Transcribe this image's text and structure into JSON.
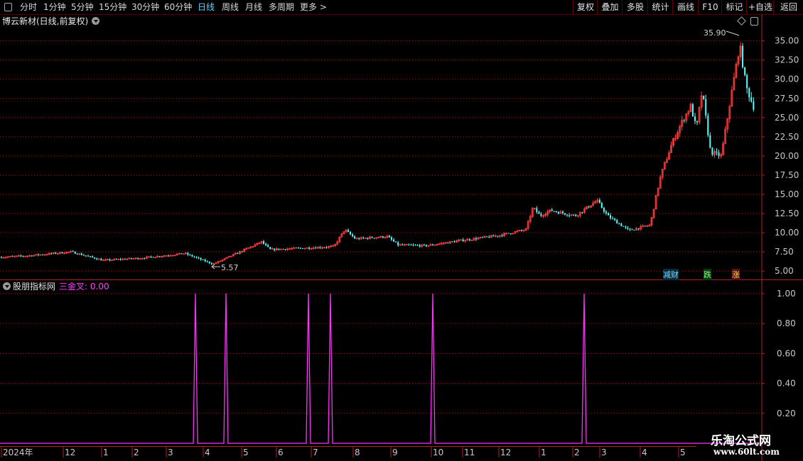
{
  "toolbar": {
    "periods": [
      {
        "label": "分时"
      },
      {
        "label": "1分钟"
      },
      {
        "label": "5分钟"
      },
      {
        "label": "15分钟"
      },
      {
        "label": "30分钟"
      },
      {
        "label": "60分钟"
      },
      {
        "label": "日线"
      },
      {
        "label": "周线"
      },
      {
        "label": "月线"
      },
      {
        "label": "多周期"
      },
      {
        "label": "更多 >"
      }
    ],
    "active_period": "日线",
    "actions": [
      {
        "label": "复权"
      },
      {
        "label": "叠加"
      },
      {
        "label": "多股"
      },
      {
        "label": "统计"
      },
      {
        "label": "画线"
      },
      {
        "label": "F10"
      },
      {
        "label": "标记"
      },
      {
        "label": "+自选"
      },
      {
        "label": "返回"
      }
    ]
  },
  "main_panel": {
    "title": "博云新材(日线,前复权)",
    "y_ticks": [
      "35.00",
      "32.50",
      "30.00",
      "27.50",
      "25.00",
      "22.50",
      "20.00",
      "17.50",
      "15.00",
      "12.50",
      "10.00",
      "7.50",
      "5.00"
    ],
    "high_label": "35.90",
    "low_label": "5.57",
    "markers": [
      "减财",
      "跌",
      "涨"
    ]
  },
  "indicator_panel": {
    "name": "股朋指标网",
    "series_label": "三金叉: 0.00",
    "y_ticks": [
      "1.00",
      "0.80",
      "0.60",
      "0.40",
      "0.20"
    ]
  },
  "x_axis": {
    "labels": [
      "2024年",
      "12",
      "1",
      "2",
      "3",
      "4",
      "5",
      "6",
      "7",
      "8",
      "9",
      "10",
      "11",
      "12",
      "1",
      "2",
      "3",
      "4",
      "5"
    ]
  },
  "watermark": {
    "cn": "乐淘公式网",
    "url": "www.60lt.com"
  },
  "colors": {
    "up": "#ff3c3c",
    "down": "#54ffff",
    "grid": "#8a1a1a",
    "indicator": "#ff30ff",
    "axis_text": "#c8c8c8"
  },
  "chart_data": {
    "type": "candlestick",
    "title": "博云新材(日线,前复权)",
    "ylim": [
      4.0,
      37.0
    ],
    "y_ticks": [
      35.0,
      32.5,
      30.0,
      27.5,
      25.0,
      22.5,
      20.0,
      17.5,
      15.0,
      12.5,
      10.0,
      7.5,
      5.0
    ],
    "x_labels": [
      "2024年",
      "12",
      "1",
      "2",
      "3",
      "4",
      "5",
      "6",
      "7",
      "8",
      "9",
      "10",
      "11",
      "12",
      "1",
      "2",
      "3",
      "4",
      "5"
    ],
    "price_path": [
      [
        0,
        6.8
      ],
      [
        40,
        7.0
      ],
      [
        100,
        7.5
      ],
      [
        145,
        6.4
      ],
      [
        200,
        6.7
      ],
      [
        260,
        7.3
      ],
      [
        300,
        5.9
      ],
      [
        340,
        7.6
      ],
      [
        368,
        8.8
      ],
      [
        380,
        7.8
      ],
      [
        430,
        8.0
      ],
      [
        470,
        8.2
      ],
      [
        485,
        10.4
      ],
      [
        500,
        9.2
      ],
      [
        545,
        9.5
      ],
      [
        560,
        8.4
      ],
      [
        600,
        8.3
      ],
      [
        650,
        9.0
      ],
      [
        700,
        9.6
      ],
      [
        740,
        10.4
      ],
      [
        750,
        13.3
      ],
      [
        760,
        12.2
      ],
      [
        775,
        12.9
      ],
      [
        810,
        12.2
      ],
      [
        840,
        14.2
      ],
      [
        855,
        12.2
      ],
      [
        885,
        10.3
      ],
      [
        915,
        11.0
      ],
      [
        925,
        15.5
      ],
      [
        930,
        17.5
      ],
      [
        945,
        21.5
      ],
      [
        960,
        24.5
      ],
      [
        972,
        26.5
      ],
      [
        980,
        23.5
      ],
      [
        988,
        28.5
      ],
      [
        1000,
        20.5
      ],
      [
        1015,
        20.0
      ],
      [
        1030,
        28.5
      ],
      [
        1041,
        34.5
      ],
      [
        1050,
        29.0
      ],
      [
        1062,
        26.0
      ]
    ],
    "high": {
      "value": 35.9,
      "label": "35.90"
    },
    "low": {
      "value": 5.57,
      "label": "5.57"
    },
    "indicator": {
      "name": "三金叉",
      "value": 0.0,
      "ylim": [
        0,
        1.08
      ],
      "y_ticks": [
        1.0,
        0.8,
        0.6,
        0.4,
        0.2
      ],
      "spike_positions": [
        275,
        318,
        434,
        465,
        609,
        822
      ],
      "spike_value": 1.0
    }
  }
}
